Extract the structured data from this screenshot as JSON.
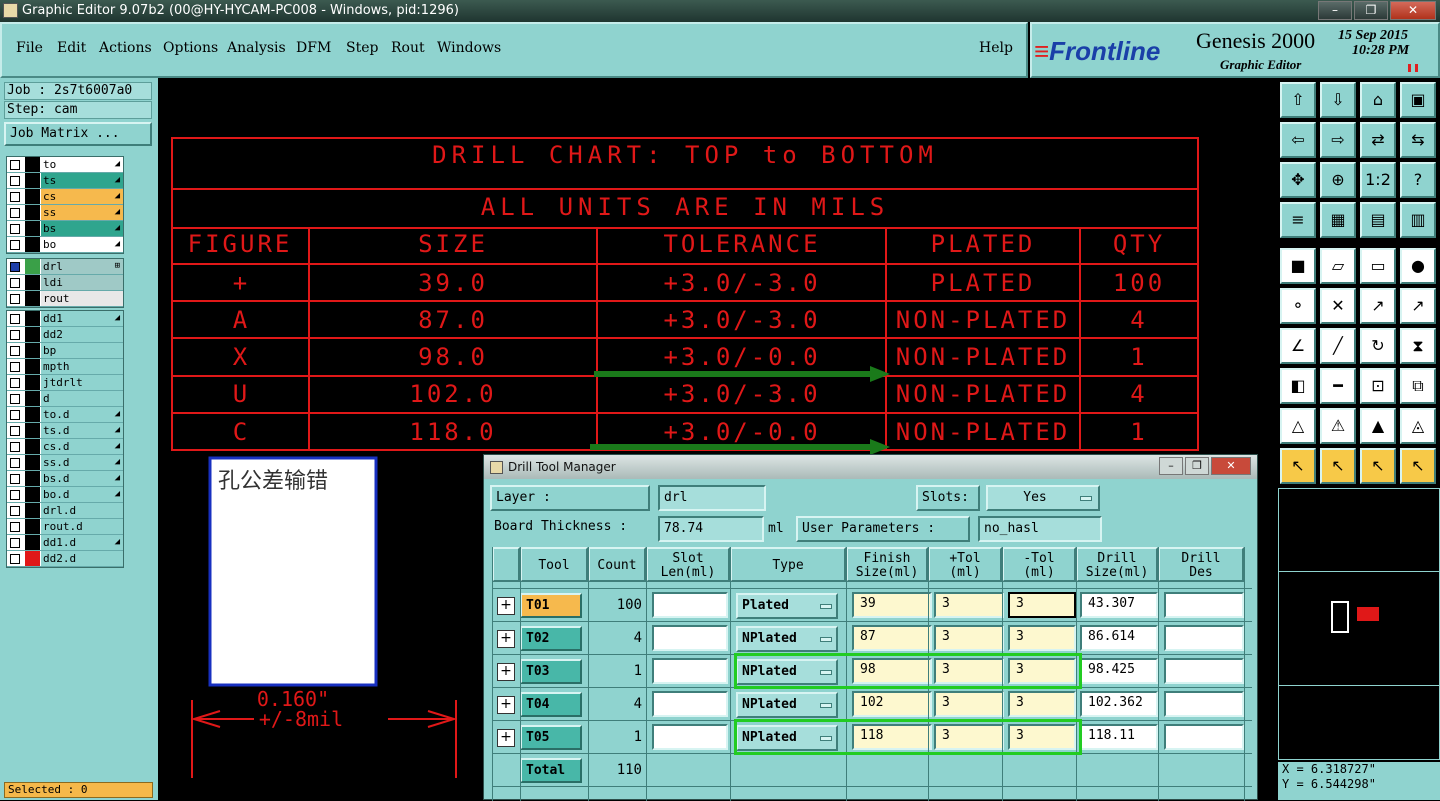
{
  "window": {
    "title": "Graphic Editor 9.07b2 (00@HY-HYCAM-PC008 - Windows, pid:1296)"
  },
  "menu": [
    "File",
    "Edit",
    "Actions",
    "Options",
    "Analysis",
    "DFM",
    "Step",
    "Rout",
    "Windows"
  ],
  "help_label": "Help",
  "brand": {
    "logo": "Frontline",
    "product": "Genesis 2000",
    "subtitle": "Graphic Editor",
    "date": "15 Sep 2015",
    "time": "10:28 PM"
  },
  "left": {
    "job": "Job : 2s7t6007a0",
    "step": "Step: cam",
    "job_matrix": "Job Matrix ...",
    "layers_group1": [
      {
        "name": "to",
        "color": "#ffffff"
      },
      {
        "name": "ts",
        "color": "#2fa58e"
      },
      {
        "name": "cs",
        "color": "#f6b94d"
      },
      {
        "name": "ss",
        "color": "#f6b94d"
      },
      {
        "name": "bs",
        "color": "#2fa58e"
      },
      {
        "name": "bo",
        "color": "#ffffff"
      }
    ],
    "layers_group2": [
      {
        "name": "drl",
        "color": "#9fc9c6"
      },
      {
        "name": "ldi",
        "color": "#9fc9c6"
      },
      {
        "name": "rout",
        "color": "#e8e8e8"
      }
    ],
    "layers_group3": [
      {
        "name": "dd1",
        "color": "#8fd3cf"
      },
      {
        "name": "dd2",
        "color": "#8fd3cf"
      },
      {
        "name": "bp",
        "color": "#8fd3cf"
      },
      {
        "name": "mpth",
        "color": "#8fd3cf"
      },
      {
        "name": "jtdrlt",
        "color": "#8fd3cf"
      },
      {
        "name": "d",
        "color": "#8fd3cf"
      },
      {
        "name": "to.d",
        "color": "#8fd3cf"
      },
      {
        "name": "ts.d",
        "color": "#8fd3cf"
      },
      {
        "name": "cs.d",
        "color": "#8fd3cf"
      },
      {
        "name": "ss.d",
        "color": "#8fd3cf"
      },
      {
        "name": "bs.d",
        "color": "#8fd3cf"
      },
      {
        "name": "bo.d",
        "color": "#8fd3cf"
      },
      {
        "name": "drl.d",
        "color": "#8fd3cf"
      },
      {
        "name": "rout.d",
        "color": "#8fd3cf"
      },
      {
        "name": "dd1.d",
        "color": "#8fd3cf"
      },
      {
        "name": "dd2.d",
        "color": "#8fd3cf"
      }
    ],
    "selected": "Selected : 0"
  },
  "drill_chart": {
    "title": "DRILL CHART: TOP to BOTTOM",
    "units": "ALL UNITS ARE IN MILS",
    "headers": [
      "FIGURE",
      "SIZE",
      "TOLERANCE",
      "PLATED",
      "QTY"
    ],
    "rows": [
      {
        "figure": "+",
        "size": "39.0",
        "tol": "+3.0/-3.0",
        "plated": "PLATED",
        "qty": "100"
      },
      {
        "figure": "A",
        "size": "87.0",
        "tol": "+3.0/-3.0",
        "plated": "NON-PLATED",
        "qty": "4"
      },
      {
        "figure": "X",
        "size": "98.0",
        "tol": "+3.0/-0.0",
        "plated": "NON-PLATED",
        "qty": "1"
      },
      {
        "figure": "U",
        "size": "102.0",
        "tol": "+3.0/-3.0",
        "plated": "NON-PLATED",
        "qty": "4"
      },
      {
        "figure": "C",
        "size": "118.0",
        "tol": "+3.0/-0.0",
        "plated": "NON-PLATED",
        "qty": "1"
      }
    ]
  },
  "note_text": "孔公差输错",
  "dimension": {
    "value": "0.160\"",
    "tol": "+/-8mil"
  },
  "coords": {
    "x": "X = 6.318727\"",
    "y": "Y = 6.544298\""
  },
  "dialog": {
    "title": "Drill Tool Manager",
    "layer_label": "Layer            :",
    "layer_value": "drl",
    "slots_label": "Slots:",
    "slots_value": "Yes",
    "board_thickness_label": "Board Thickness :",
    "board_thickness_value": "78.74",
    "board_thickness_unit": "ml",
    "user_params_label": "User Parameters :",
    "user_params_value": "no_hasl",
    "columns": [
      "Tool",
      "Count",
      "Slot\nLen(ml)",
      "Type",
      "Finish\nSize(ml)",
      "+Tol\n(ml)",
      "-Tol\n(ml)",
      "Drill\nSize(ml)",
      "Drill\nDes"
    ],
    "rows": [
      {
        "tool": "T01",
        "count": "100",
        "type": "Plated",
        "finish": "39",
        "ptol": "3",
        "mtol": "3",
        "drill": "43.307"
      },
      {
        "tool": "T02",
        "count": "4",
        "type": "NPlated",
        "finish": "87",
        "ptol": "3",
        "mtol": "3",
        "drill": "86.614"
      },
      {
        "tool": "T03",
        "count": "1",
        "type": "NPlated",
        "finish": "98",
        "ptol": "3",
        "mtol": "3",
        "drill": "98.425"
      },
      {
        "tool": "T04",
        "count": "4",
        "type": "NPlated",
        "finish": "102",
        "ptol": "3",
        "mtol": "3",
        "drill": "102.362"
      },
      {
        "tool": "T05",
        "count": "1",
        "type": "NPlated",
        "finish": "118",
        "ptol": "3",
        "mtol": "3",
        "drill": "118.11"
      }
    ],
    "total_label": "Total",
    "total_value": "110"
  },
  "colors": {
    "chart_red": "#e01818",
    "ui_teal": "#8fd3cf",
    "highlight_green": "#22cc22",
    "arrow_green": "#1a7a1a"
  }
}
